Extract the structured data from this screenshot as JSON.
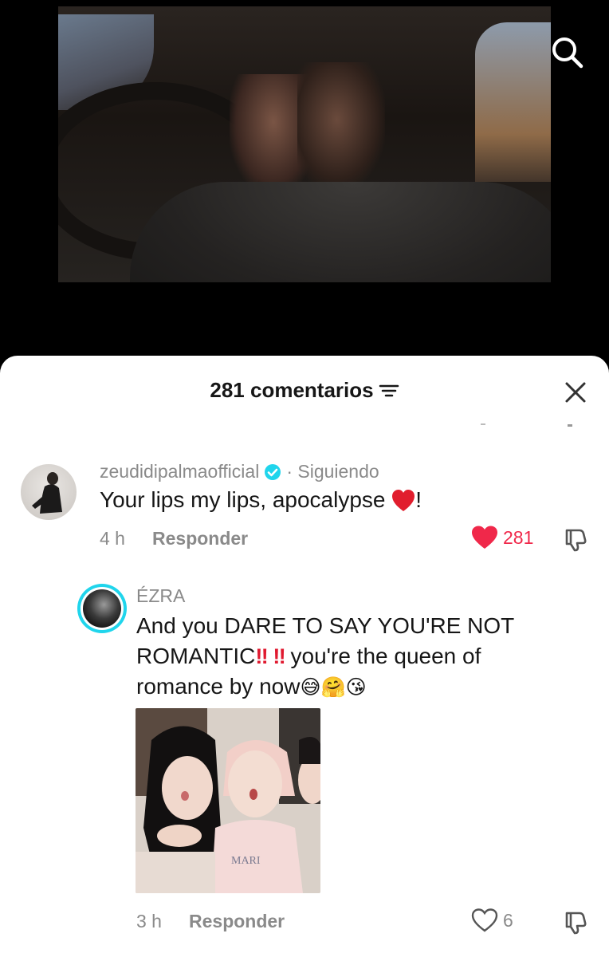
{
  "header": {
    "comment_count_label": "281 comentarios"
  },
  "icons": {
    "search": "search-icon",
    "filter": "filter-icon",
    "close": "close-icon",
    "heart": "heart-icon",
    "dislike": "thumbs-down-icon"
  },
  "colors": {
    "accent_like": "#f0284a",
    "verified": "#20d5ec",
    "text_primary": "#161616",
    "text_secondary": "#8a8a8a"
  },
  "comments": [
    {
      "username": "zeudidipalmaofficial",
      "follow_status": "· Siguiendo",
      "verified": true,
      "text": "Your lips my lips, apocalypse ",
      "text_suffix": "!",
      "emojis": [
        "❤️"
      ],
      "time": "4 h",
      "reply_label": "Responder",
      "likes": "281",
      "liked": true
    },
    {
      "username": "ÉZRA",
      "text_line1": "And you DARE TO SAY YOU'RE NOT",
      "text_line2a": "ROMANTIC",
      "exclaim": "‼",
      "text_line2b": " you're the queen of",
      "text_line3": "romance by now",
      "emojis": [
        "😅",
        "🤗",
        "😘"
      ],
      "has_story_ring": true,
      "time": "3 h",
      "reply_label": "Responder",
      "likes": "6",
      "liked": false
    }
  ]
}
